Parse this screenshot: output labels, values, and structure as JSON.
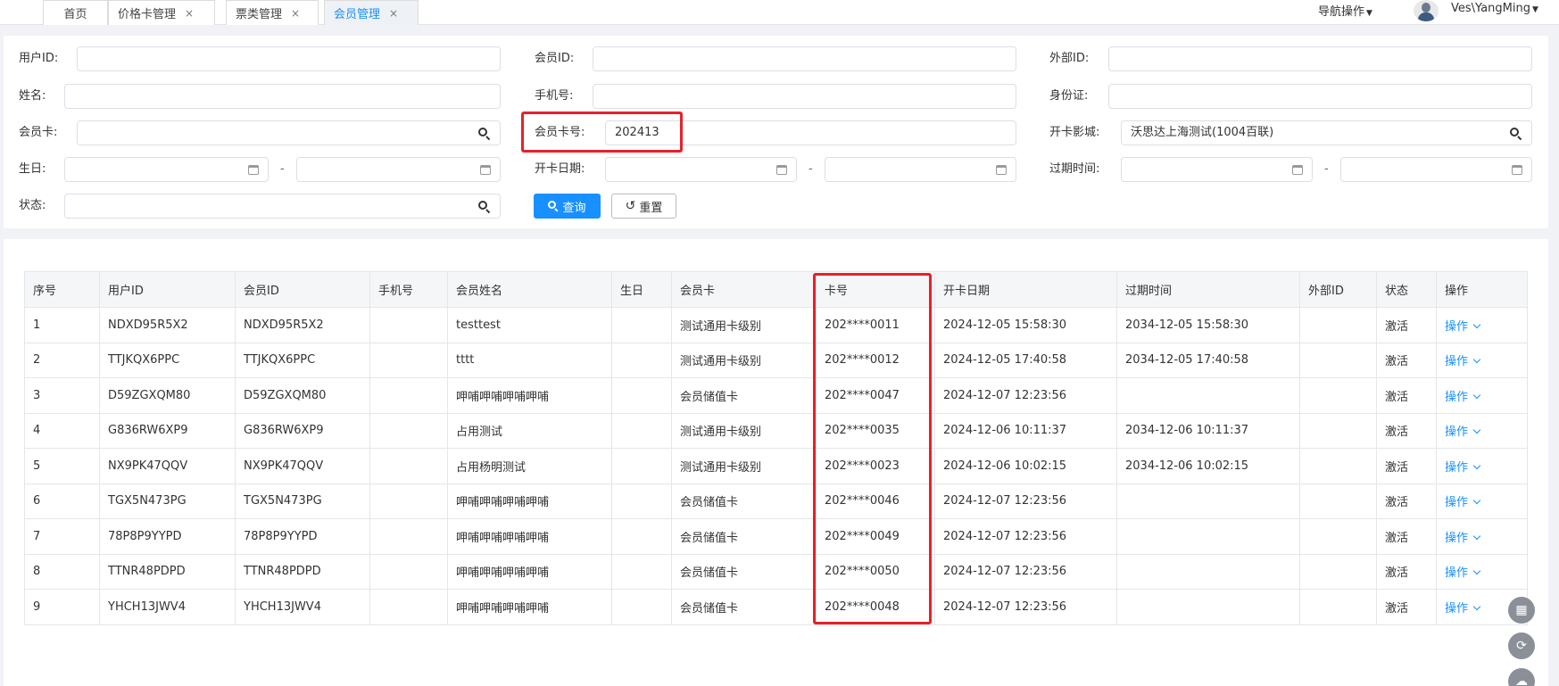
{
  "tabs": [
    {
      "label": "首页",
      "closable": false,
      "active": false
    },
    {
      "label": "价格卡管理",
      "closable": true,
      "active": false
    },
    {
      "label": "票类管理",
      "closable": true,
      "active": false
    },
    {
      "label": "会员管理",
      "closable": true,
      "active": true
    }
  ],
  "header": {
    "nav_label": "导航操作",
    "user_name": "Ves\\YangMing",
    "close_symbol": "×"
  },
  "filters": {
    "user_id": {
      "label": "用户ID:",
      "value": ""
    },
    "member_id": {
      "label": "会员ID:",
      "value": ""
    },
    "external_id": {
      "label": "外部ID:",
      "value": ""
    },
    "name": {
      "label": "姓名:",
      "value": ""
    },
    "phone": {
      "label": "手机号:",
      "value": ""
    },
    "id_card": {
      "label": "身份证:",
      "value": ""
    },
    "member_card": {
      "label": "会员卡:",
      "value": ""
    },
    "card_no": {
      "label": "会员卡号:",
      "value": "202413"
    },
    "open_cinema": {
      "label": "开卡影城:",
      "value": "沃思达上海测试(1004百联)"
    },
    "birthday": {
      "label": "生日:",
      "start": "",
      "end": ""
    },
    "open_date": {
      "label": "开卡日期:",
      "start": "",
      "end": ""
    },
    "expire": {
      "label": "过期时间:",
      "start": "",
      "end": ""
    },
    "status": {
      "label": "状态:",
      "value": ""
    },
    "range_sep": "-"
  },
  "buttons": {
    "query": "查询",
    "reset": "重置"
  },
  "table": {
    "columns": [
      "序号",
      "用户ID",
      "会员ID",
      "手机号",
      "会员姓名",
      "生日",
      "会员卡",
      "卡号",
      "开卡日期",
      "过期时间",
      "外部ID",
      "状态",
      "操作"
    ],
    "op_label": "操作",
    "rows": [
      [
        "1",
        "NDXD95R5X2",
        "NDXD95R5X2",
        "",
        "testtest",
        "",
        "测试通用卡级别",
        "202****0011",
        "2024-12-05 15:58:30",
        "2034-12-05 15:58:30",
        "",
        "激活"
      ],
      [
        "2",
        "TTJKQX6PPC",
        "TTJKQX6PPC",
        "",
        "tttt",
        "",
        "测试通用卡级别",
        "202****0012",
        "2024-12-05 17:40:58",
        "2034-12-05 17:40:58",
        "",
        "激活"
      ],
      [
        "3",
        "D59ZGXQM80",
        "D59ZGXQM80",
        "",
        "呷哺呷哺呷哺呷哺",
        "",
        "会员储值卡",
        "202****0047",
        "2024-12-07 12:23:56",
        "",
        "",
        "激活"
      ],
      [
        "4",
        "G836RW6XP9",
        "G836RW6XP9",
        "",
        "占用测试",
        "",
        "测试通用卡级别",
        "202****0035",
        "2024-12-06 10:11:37",
        "2034-12-06 10:11:37",
        "",
        "激活"
      ],
      [
        "5",
        "NX9PK47QQV",
        "NX9PK47QQV",
        "",
        "占用杨明测试",
        "",
        "测试通用卡级别",
        "202****0023",
        "2024-12-06 10:02:15",
        "2034-12-06 10:02:15",
        "",
        "激活"
      ],
      [
        "6",
        "TGX5N473PG",
        "TGX5N473PG",
        "",
        "呷哺呷哺呷哺呷哺",
        "",
        "会员储值卡",
        "202****0046",
        "2024-12-07 12:23:56",
        "",
        "",
        "激活"
      ],
      [
        "7",
        "78P8P9YYPD",
        "78P8P9YYPD",
        "",
        "呷哺呷哺呷哺呷哺",
        "",
        "会员储值卡",
        "202****0049",
        "2024-12-07 12:23:56",
        "",
        "",
        "激活"
      ],
      [
        "8",
        "TTNR48PDPD",
        "TTNR48PDPD",
        "",
        "呷哺呷哺呷哺呷哺",
        "",
        "会员储值卡",
        "202****0050",
        "2024-12-07 12:23:56",
        "",
        "",
        "激活"
      ],
      [
        "9",
        "YHCH13JWV4",
        "YHCH13JWV4",
        "",
        "呷哺呷哺呷哺呷哺",
        "",
        "会员储值卡",
        "202****0048",
        "2024-12-07 12:23:56",
        "",
        "",
        "激活"
      ]
    ]
  },
  "colors": {
    "primary": "#1890ff",
    "highlight": "#e8202a"
  },
  "icons": [
    "search-icon",
    "calendar-icon",
    "reset-icon",
    "chevron-down-icon",
    "layout-icon",
    "refresh-icon",
    "cloud-upload-icon"
  ]
}
